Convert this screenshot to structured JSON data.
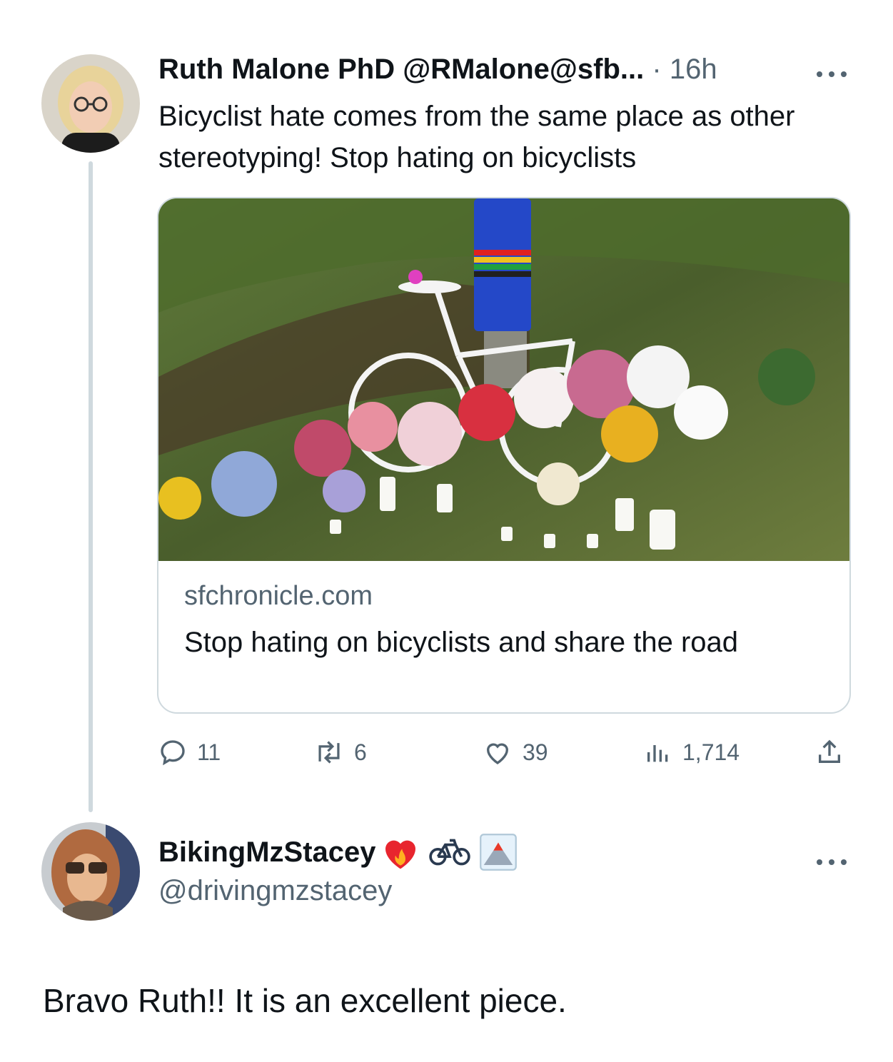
{
  "tweet": {
    "author_name": "Ruth Malone PhD",
    "author_handle": "@RMalone@sfb...",
    "separator": "·",
    "time": "16h",
    "text": "Bicyclist hate comes from the same place as other stereotyping! Stop hating on bicyclists",
    "card": {
      "domain": "sfchronicle.com",
      "title": "Stop hating on bicyclists and share the road"
    },
    "actions": {
      "replies": "11",
      "retweets": "6",
      "likes": "39",
      "views": "1,714"
    }
  },
  "reply": {
    "author_name": "BikingMzStacey",
    "author_handle": "@drivingmzstacey",
    "text": "Bravo Ruth!! It is an excellent piece."
  },
  "colors": {
    "muted": "#536471",
    "thread_line": "#cfd9de",
    "card_border": "#cfd9de"
  },
  "icons": [
    "avatar",
    "more-icon",
    "reply-icon",
    "retweet-icon",
    "like-icon",
    "views-icon",
    "share-icon",
    "heart-on-fire-emoji",
    "bicycle-emoji",
    "volcano-emoji"
  ]
}
